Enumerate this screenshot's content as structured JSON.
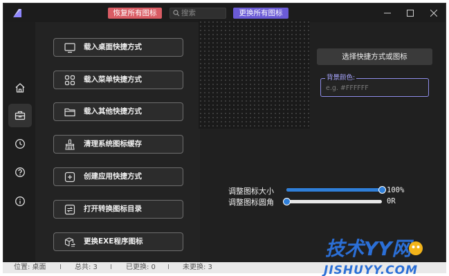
{
  "titlebar": {
    "restore_label": "恢复所有图标",
    "search_placeholder": "搜索",
    "replace_all_label": "更换所有图标"
  },
  "rail": {
    "items": [
      "home-icon",
      "toolbox-icon",
      "clock-icon",
      "help-icon",
      "info-icon"
    ],
    "active": "toolbox-icon"
  },
  "actions": [
    {
      "label": "载入桌面快捷方式",
      "icon": "monitor-icon"
    },
    {
      "label": "载入菜单快捷方式",
      "icon": "grid-icon"
    },
    {
      "label": "载入其他快捷方式",
      "icon": "folder-icon"
    },
    {
      "label": "清理系统图标缓存",
      "icon": "broom-icon"
    },
    {
      "label": "创建应用快捷方式",
      "icon": "add-square-icon"
    },
    {
      "label": "打开转换图标目录",
      "icon": "folder-convert-icon"
    },
    {
      "label": "更换EXE程序图标",
      "icon": "box-swap-icon"
    }
  ],
  "panel": {
    "choose_label": "选择快捷方式或图标",
    "bg_color_label": "背景颜色:",
    "bg_color_placeholder": "e.g. #FFFFFF"
  },
  "sliders": {
    "size": {
      "label": "调整图标大小",
      "value": 100,
      "display": "100%"
    },
    "radius": {
      "label": "调整图标圆角",
      "value": 0,
      "display": "0R"
    }
  },
  "status": {
    "location": "位置: 桌面",
    "total": "总共: 3",
    "replaced": "已更换: 0",
    "not_replaced": "未更换: 3",
    "separator": "I"
  },
  "watermark": {
    "text_top": "技术YY网",
    "text_bottom": "JISHUYY.COM"
  },
  "colors": {
    "restore": "#d95c64",
    "replace_all": "#6b5bd6",
    "accent": "#2f7fd9",
    "field_border": "#8f8de9",
    "watermark": "#2b6fd6"
  }
}
